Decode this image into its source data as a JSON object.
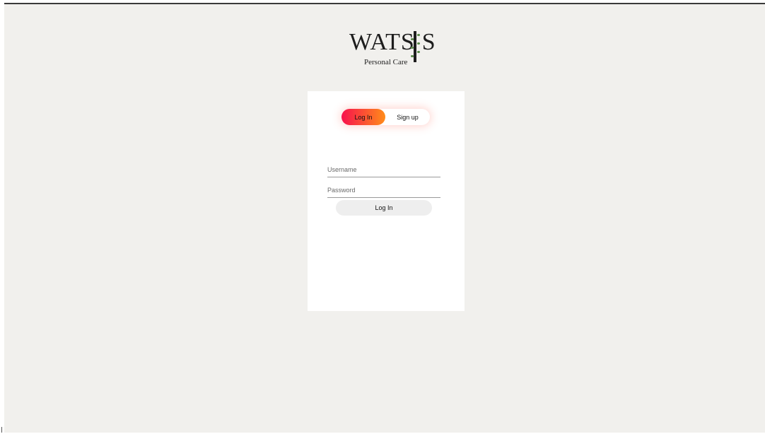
{
  "brand": {
    "wordmark_left": "WATS",
    "wordmark_right": "S",
    "tagline": "Personal Care"
  },
  "auth_toggle": {
    "login_label": "Log In",
    "signup_label": "Sign up",
    "active": "login"
  },
  "login_form": {
    "username_placeholder": "Username",
    "password_placeholder": "Password",
    "submit_label": "Log In"
  },
  "colors": {
    "page_background": "#f1f0ed",
    "card_background": "#ffffff",
    "gradient_start": "#f7114d",
    "gradient_end": "#ff8c1a",
    "submit_background": "#eeeeee"
  },
  "icons": {
    "logo": "watsons-leaf-logo"
  }
}
